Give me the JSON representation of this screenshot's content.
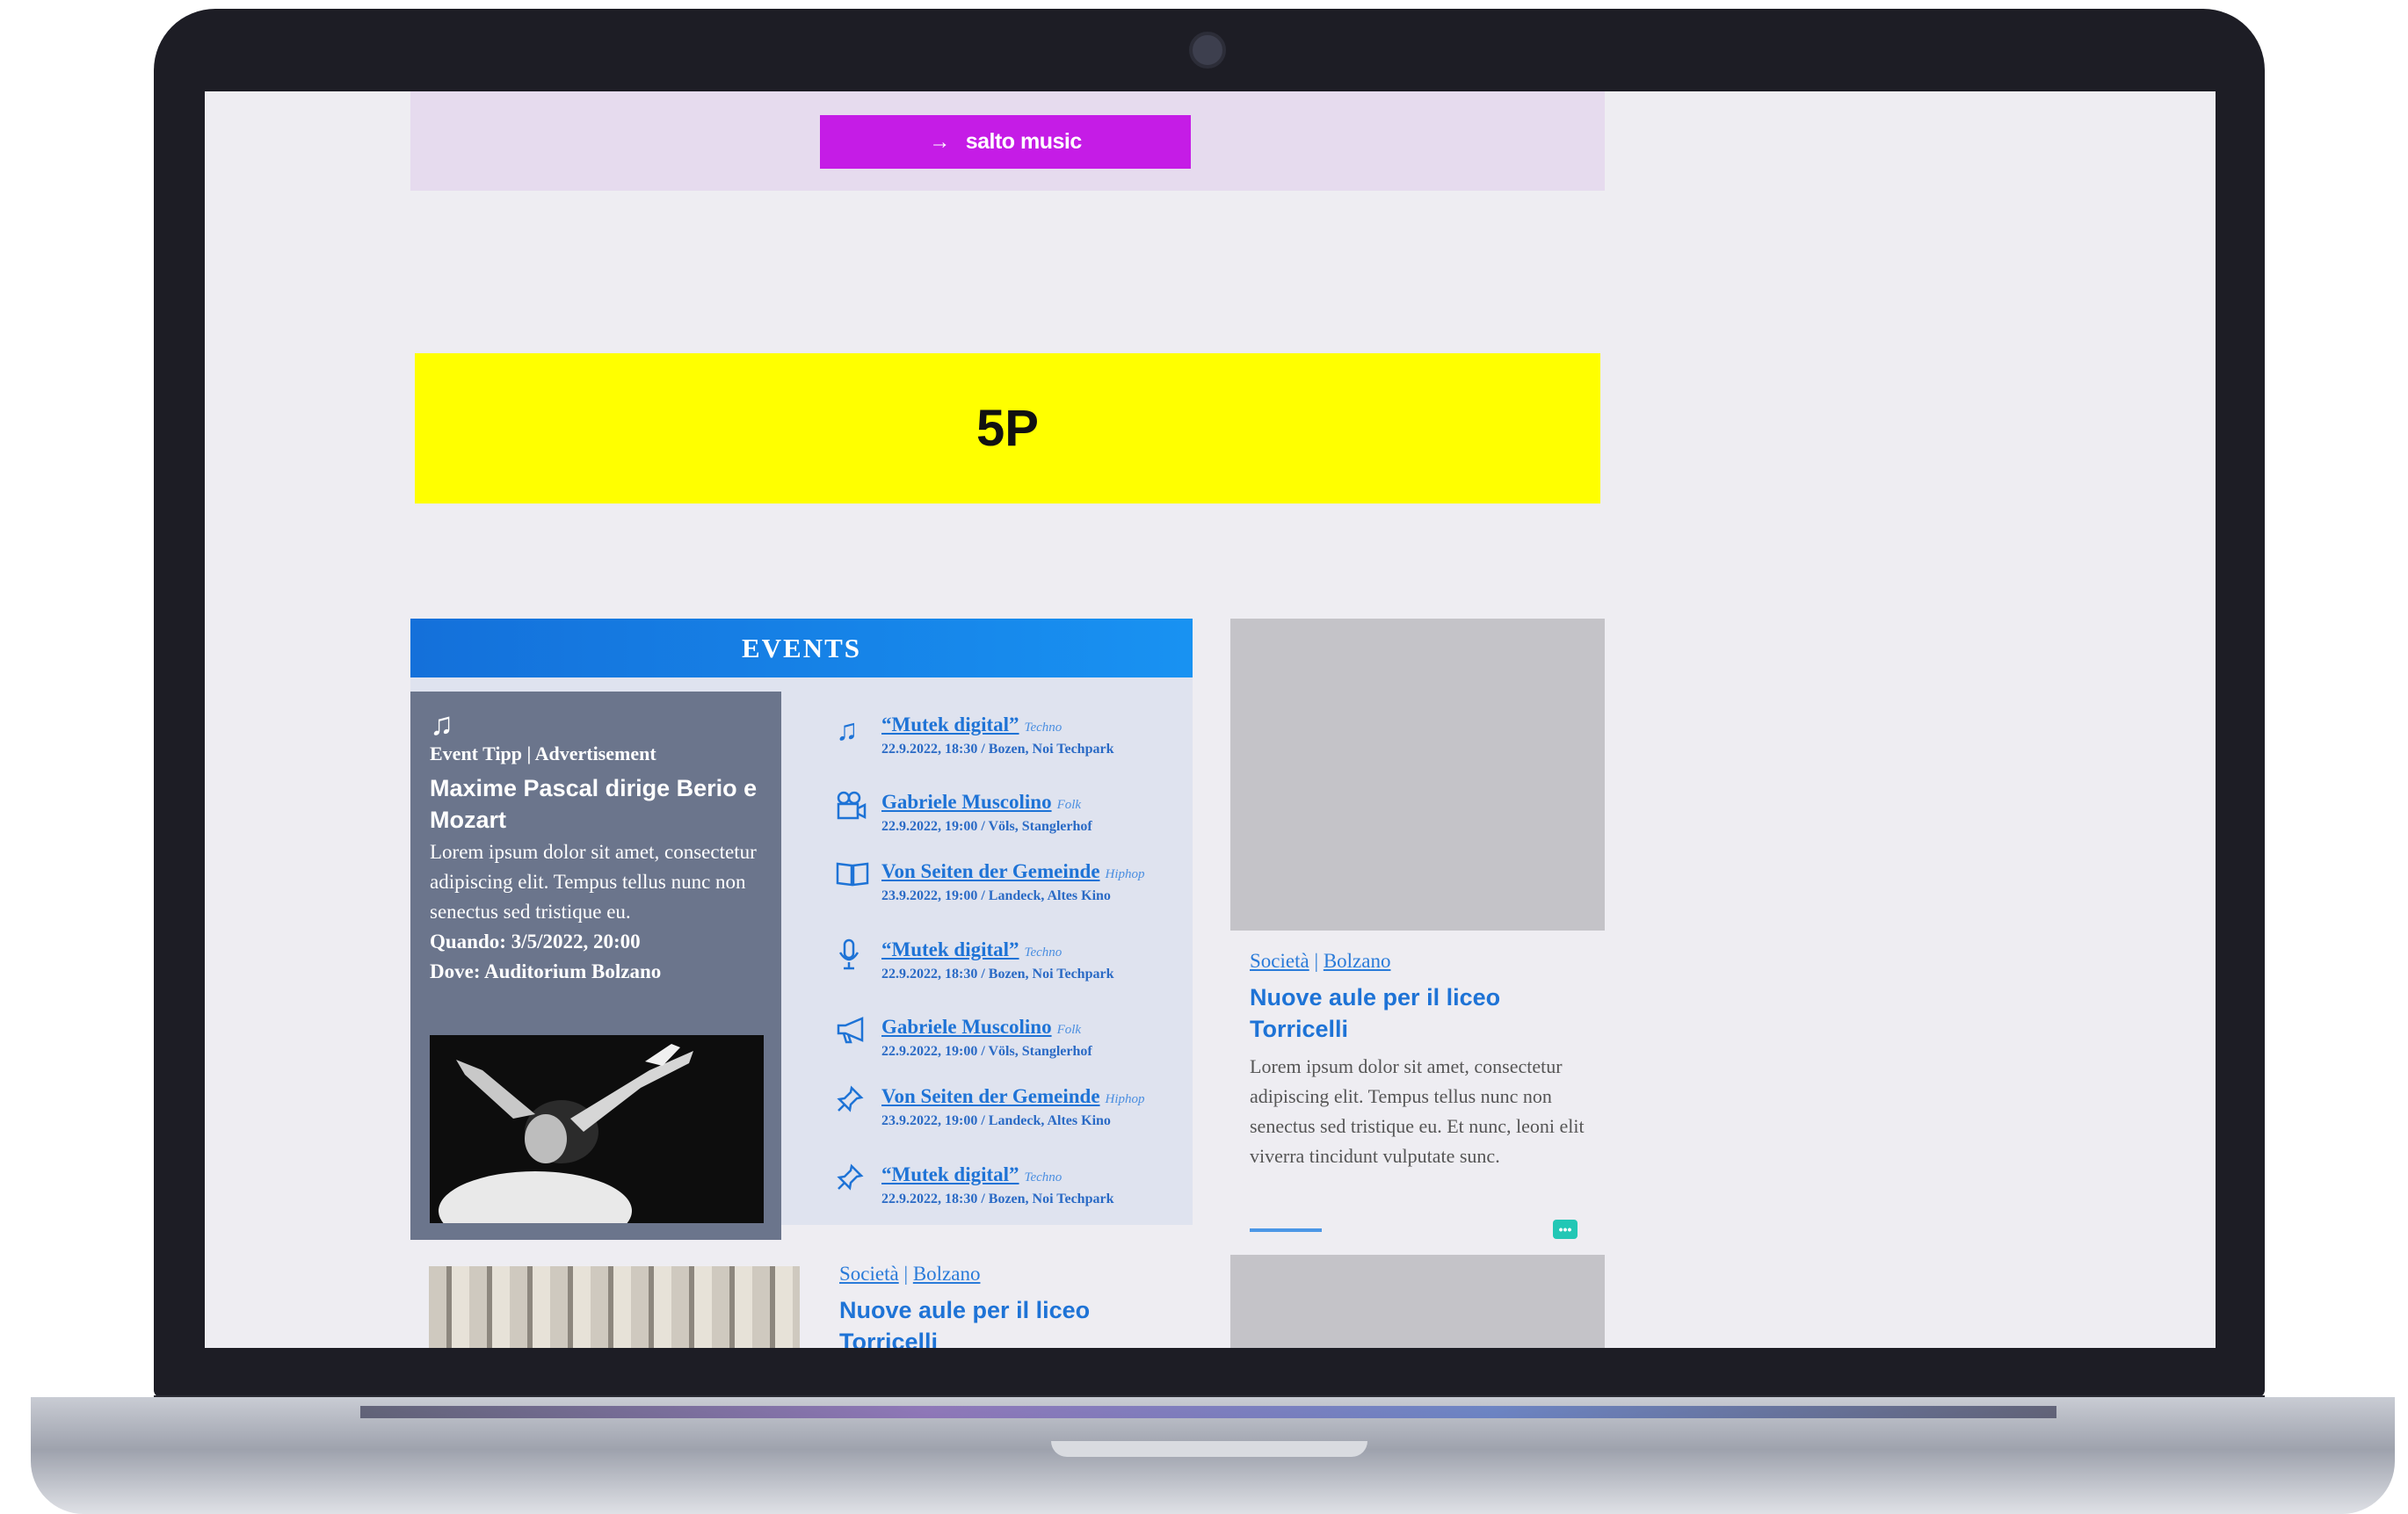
{
  "promo": {
    "button_label": "salto music",
    "arrow_icon": "arrow-right-icon"
  },
  "ad_banner": {
    "label": "5P"
  },
  "events": {
    "heading": "EVENTS",
    "tipp": {
      "icon": "music-note-icon",
      "kicker": "Event Tipp | Advertisement",
      "title": "Maxime Pascal dirige Berio e Mozart",
      "text": "Lorem ipsum dolor sit amet, consectetur adipiscing elit. Tempus tellus nunc non senectus sed tristique eu.",
      "when": "Quando: 3/5/2022, 20:00",
      "where": "Dove: Auditorium Bolzano"
    },
    "items": [
      {
        "icon": "music-note-icon",
        "title": "“Mutek digital”",
        "genre": "Techno",
        "meta": "22.9.2022, 18:30 / Bozen, Noi Techpark"
      },
      {
        "icon": "video-camera-icon",
        "title": "Gabriele Muscolino",
        "genre": "Folk",
        "meta": "22.9.2022, 19:00 / Völs, Stanglerhof"
      },
      {
        "icon": "book-icon",
        "title": "Von Seiten der Gemeinde",
        "genre": "Hiphop",
        "meta": "23.9.2022, 19:00 / Landeck, Altes Kino"
      },
      {
        "icon": "microphone-icon",
        "title": "“Mutek digital”",
        "genre": "Techno",
        "meta": "22.9.2022, 18:30 / Bozen, Noi Techpark"
      },
      {
        "icon": "megaphone-icon",
        "title": "Gabriele Muscolino",
        "genre": "Folk",
        "meta": "22.9.2022, 19:00 / Völs, Stanglerhof"
      },
      {
        "icon": "pin-icon",
        "title": "Von Seiten der Gemeinde",
        "genre": "Hiphop",
        "meta": "23.9.2022, 19:00 / Landeck, Altes Kino"
      },
      {
        "icon": "pin-icon",
        "title": "“Mutek digital”",
        "genre": "Techno",
        "meta": "22.9.2022, 18:30 / Bozen, Noi Techpark"
      }
    ]
  },
  "side_article": {
    "category": "Società",
    "location": "Bolzano",
    "title": "Nuove aule per il liceo Torricelli",
    "text": "Lorem ipsum dolor sit amet, consectetur adipiscing elit. Tempus tellus nunc non senectus sed tristique eu. Et nunc, leoni elit viverra tincidunt vulputate sunc.",
    "comment_icon": "comment-icon"
  },
  "bottom_article": {
    "category": "Società",
    "location": "Bolzano",
    "title": "Nuove aule per il liceo Torricelli"
  }
}
